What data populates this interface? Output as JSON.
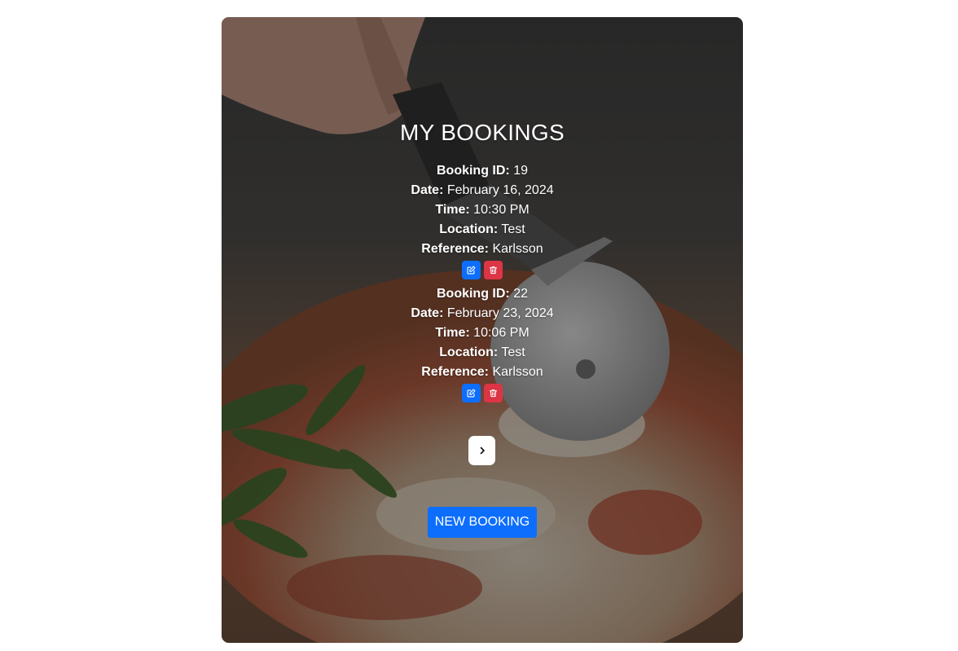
{
  "page": {
    "title": "MY BOOKINGS",
    "background_image": "pizza-cutter-photo",
    "accent_color": "#0d6efd",
    "danger_color": "#dc3545"
  },
  "bookings": [
    {
      "id_label": "Booking ID:",
      "id": "19",
      "date_label": "Date:",
      "date": "February 16, 2024",
      "time_label": "Time:",
      "time": "10:30 PM",
      "location_label": "Location:",
      "location": "Test",
      "reference_label": "Reference:",
      "reference": "Karlsson",
      "edit_icon": "edit-icon",
      "delete_icon": "trash-icon"
    },
    {
      "id_label": "Booking ID:",
      "id": "22",
      "date_label": "Date:",
      "date": "February 23, 2024",
      "time_label": "Time:",
      "time": "10:06 PM",
      "location_label": "Location:",
      "location": "Test",
      "reference_label": "Reference:",
      "reference": "Karlsson",
      "edit_icon": "edit-icon",
      "delete_icon": "trash-icon"
    }
  ],
  "pagination": {
    "next_icon": "chevron-right-icon"
  },
  "new_booking": {
    "label": "NEW BOOKING"
  }
}
